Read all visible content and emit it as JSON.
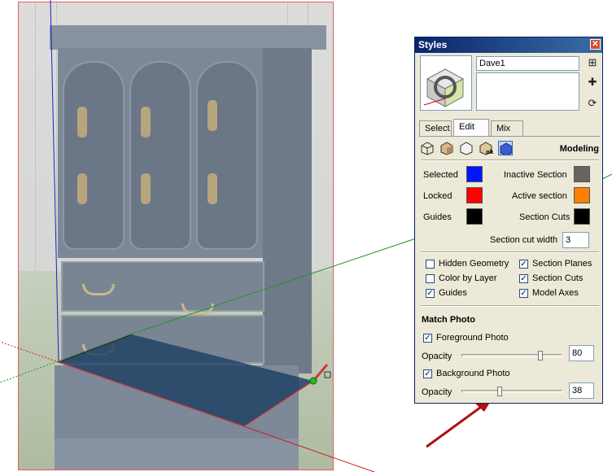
{
  "styles_panel": {
    "title": "Styles",
    "style_name": "Dave1",
    "tabs": [
      "Select",
      "Edit",
      "Mix"
    ],
    "active_tab": "Edit",
    "mode_label": "Modeling",
    "edit_icons": [
      "edge-settings-icon",
      "face-settings-icon",
      "background-settings-icon",
      "watermark-settings-icon",
      "modeling-settings-icon"
    ],
    "colors": {
      "selected": {
        "label": "Selected",
        "color": "#0015ff"
      },
      "locked": {
        "label": "Locked",
        "color": "#ff0000"
      },
      "guides": {
        "label": "Guides",
        "color": "#000000"
      },
      "inactive_section": {
        "label": "Inactive Section",
        "color": "#67655e"
      },
      "active_section": {
        "label": "Active section",
        "color": "#ff8000"
      },
      "section_cuts": {
        "label": "Section Cuts",
        "color": "#000000"
      }
    },
    "section_cut_width": {
      "label": "Section cut width",
      "value": "3"
    },
    "checkboxes": {
      "hidden_geometry": {
        "label": "Hidden Geometry",
        "checked": false
      },
      "color_by_layer": {
        "label": "Color by Layer",
        "checked": false
      },
      "guides": {
        "label": "Guides",
        "checked": true
      },
      "section_planes": {
        "label": "Section Planes",
        "checked": true
      },
      "section_cuts": {
        "label": "Section Cuts",
        "checked": true
      },
      "model_axes": {
        "label": "Model Axes",
        "checked": true
      }
    },
    "match_photo": {
      "title": "Match Photo",
      "foreground": {
        "label": "Foreground Photo",
        "checked": true,
        "opacity_label": "Opacity",
        "opacity": "80"
      },
      "background": {
        "label": "Background Photo",
        "checked": true,
        "opacity_label": "Opacity",
        "opacity": "38"
      }
    }
  },
  "accent_colors": {
    "titlebar": "#0a246a",
    "annotation_arrow": "#b01010",
    "axis_red": "#cc0000",
    "axis_green": "#009900",
    "axis_blue": "#0000cc"
  }
}
